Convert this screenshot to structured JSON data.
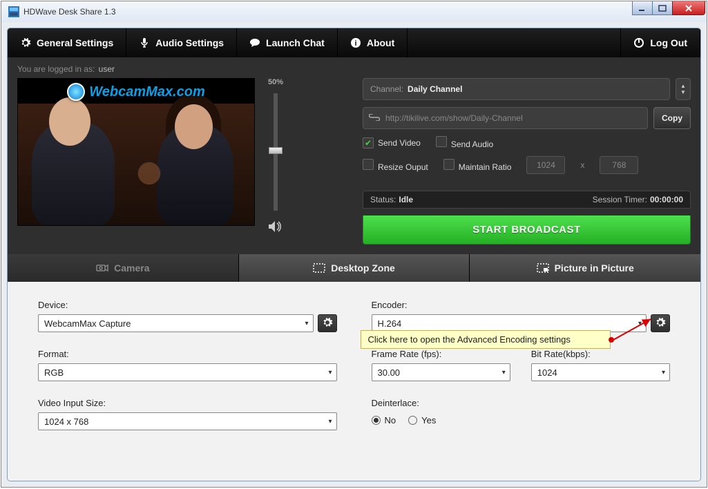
{
  "window": {
    "title": "HDWave Desk Share 1.3"
  },
  "nav": {
    "general": "General Settings",
    "audio": "Audio Settings",
    "chat": "Launch Chat",
    "about": "About",
    "logout": "Log Out"
  },
  "login": {
    "prefix": "You are logged in as:",
    "user": "user"
  },
  "preview": {
    "watermark": "WebcamMax.com",
    "volume_pct": "50%"
  },
  "channel": {
    "label": "Channel:",
    "value": "Daily Channel",
    "url": "http://tikilive.com/show/Daily-Channel",
    "copy": "Copy"
  },
  "options": {
    "send_video": "Send Video",
    "send_audio": "Send Audio",
    "resize_output": "Resize Ouput",
    "maintain_ratio": "Maintain Ratio",
    "width": "1024",
    "height": "768"
  },
  "status": {
    "label": "Status:",
    "value": "Idle",
    "timer_label": "Session Timer:",
    "timer_value": "00:00:00"
  },
  "broadcast": "START BROADCAST",
  "tabs": {
    "camera": "Camera",
    "desktop": "Desktop Zone",
    "pip": "Picture in Picture"
  },
  "camera": {
    "device_label": "Device:",
    "device_value": "WebcamMax Capture",
    "format_label": "Format:",
    "format_value": "RGB",
    "size_label": "Video Input Size:",
    "size_value": "1024 x 768"
  },
  "encoder": {
    "encoder_label": "Encoder:",
    "encoder_value": "H.264",
    "framerate_label": "Frame Rate (fps):",
    "framerate_value": "30.00",
    "bitrate_label": "Bit Rate(kbps):",
    "bitrate_value": "1024",
    "deinterlace_label": "Deinterlace:",
    "deinterlace_no": "No",
    "deinterlace_yes": "Yes"
  },
  "tooltip": "Click here to open the Advanced Encoding settings"
}
